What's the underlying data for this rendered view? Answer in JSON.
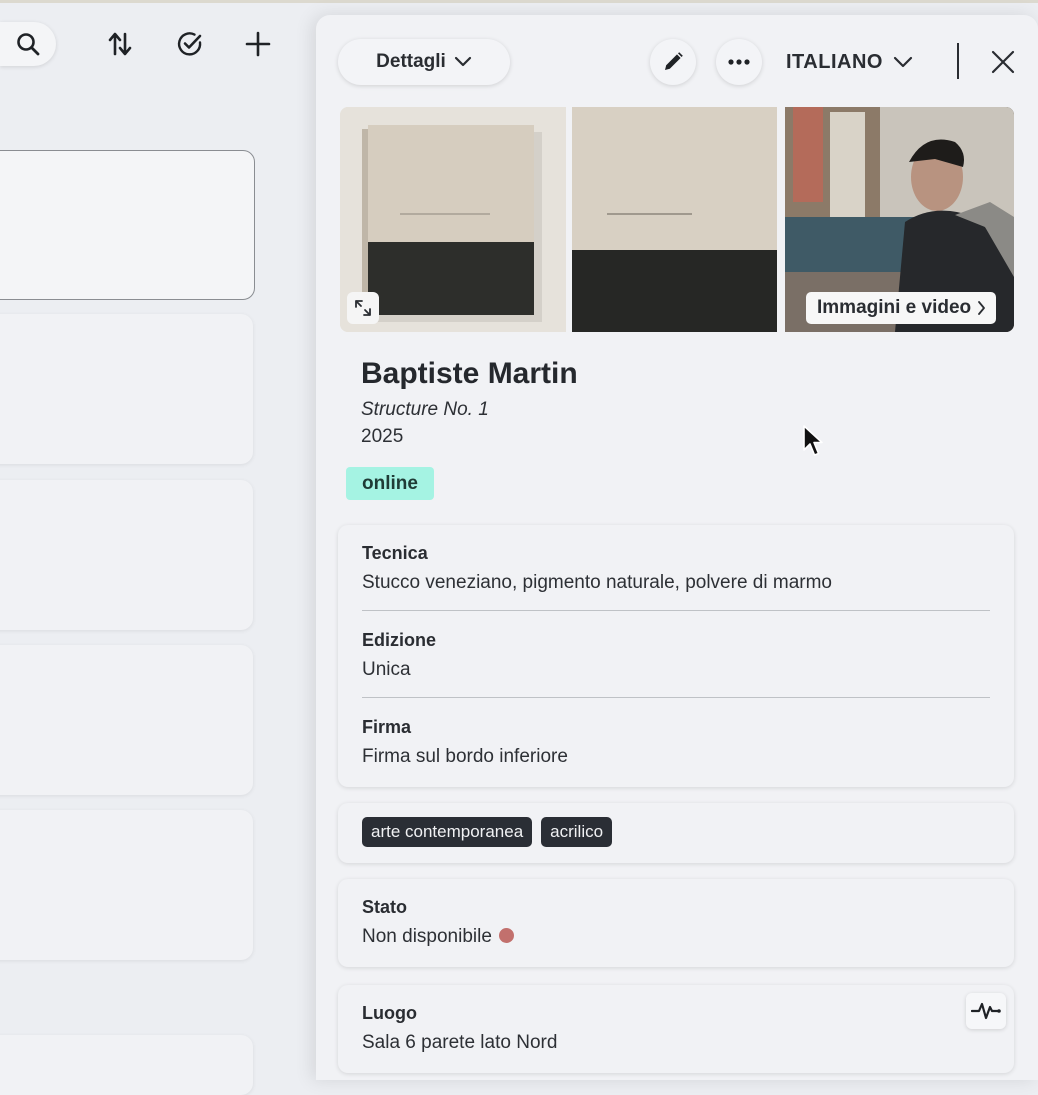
{
  "toolbar": {
    "search_icon": "search-icon",
    "sort_icon": "sort-arrows-icon",
    "select_icon": "check-circle-icon",
    "add_icon": "plus-icon"
  },
  "panel": {
    "view_select": "Dettagli",
    "language": "ITALIANO",
    "gallery": {
      "media_link": "Immagini e video"
    },
    "artwork": {
      "artist": "Baptiste Martin",
      "title": "Structure No. 1",
      "year": "2025",
      "status_badge": "online"
    },
    "properties": [
      {
        "label": "Tecnica",
        "value": "Stucco veneziano, pigmento naturale, polvere di marmo"
      },
      {
        "label": "Edizione",
        "value": "Unica"
      },
      {
        "label": "Firma",
        "value": "Firma sul bordo inferiore"
      }
    ],
    "tags": [
      "arte contemporanea",
      "acrilico"
    ],
    "state": {
      "label": "Stato",
      "value": "Non disponibile",
      "color": "#c2706d"
    },
    "location": {
      "label": "Luogo",
      "value": "Sala 6 parete lato Nord"
    }
  },
  "colors": {
    "status_online": "#a5f3e3",
    "tag_bg": "#2a2e35",
    "panel_bg": "#f1f2f5"
  }
}
